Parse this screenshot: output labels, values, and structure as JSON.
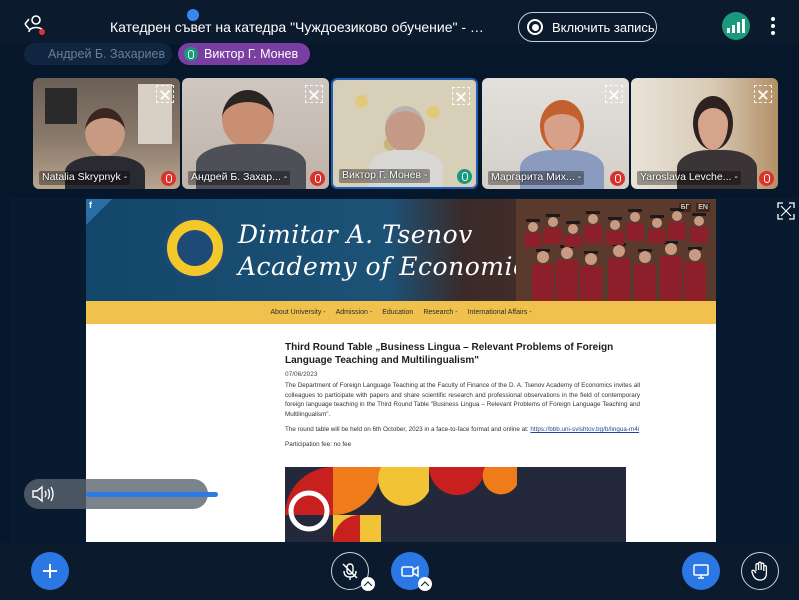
{
  "topbar": {
    "title": "Катедрен съвет на катедра \"Чуждоезиково обучение\" - мандат ...",
    "record_label": "Включить запись"
  },
  "talkers": [
    {
      "name": "Андрей Б. Захариев",
      "active": false
    },
    {
      "name": "Виктор Г. Монев",
      "active": true
    }
  ],
  "participants": [
    {
      "name": "Natalia Skrypnyk -",
      "mic": "off"
    },
    {
      "name": "Андрей Б. Захар... -",
      "mic": "off"
    },
    {
      "name": "Виктор Г. Монев -",
      "mic": "on"
    },
    {
      "name": "Маргарита Мих... -",
      "mic": "off"
    },
    {
      "name": "Yaroslava Levche... -",
      "mic": "off"
    }
  ],
  "site": {
    "fb": "f",
    "name_line1": "Dimitar A. Tsenov",
    "name_line2": "Academy of Economics",
    "langs": [
      "БГ",
      "EN"
    ],
    "nav": [
      "About University -",
      "Admission -",
      "Education",
      "Research -",
      "International Affairs -"
    ],
    "article": {
      "title": "Third Round Table „Business Lingua – Relevant Problems of Foreign Language Teaching and Multilingualism\"",
      "date": "07/06/2023",
      "body1": "The Department of Foreign Language Teaching at the Faculty of Finance of the D. A. Tsenov Academy of Economics invites all colleagues to participate with papers and share scientific research and professional observations in the field of contemporary foreign language teaching in the Third Round Table \"Business Lingua – Relevant Problems of Foreign Language Teaching and Multilingualism\".",
      "body2": "The round table will be held on 6th October, 2023 in a face-to-face format and online at:",
      "link": "https://bbb.uni-svishtov.bg/b/lingua-m4i",
      "fee": "Participation fee: no fee"
    }
  },
  "colors": {
    "accent_blue": "#2b78e4",
    "talker_purple": "#7a3ea3",
    "mic_on": "#1a9a7c",
    "mic_off": "#d9322c",
    "nav_yellow": "#f1c14d"
  }
}
